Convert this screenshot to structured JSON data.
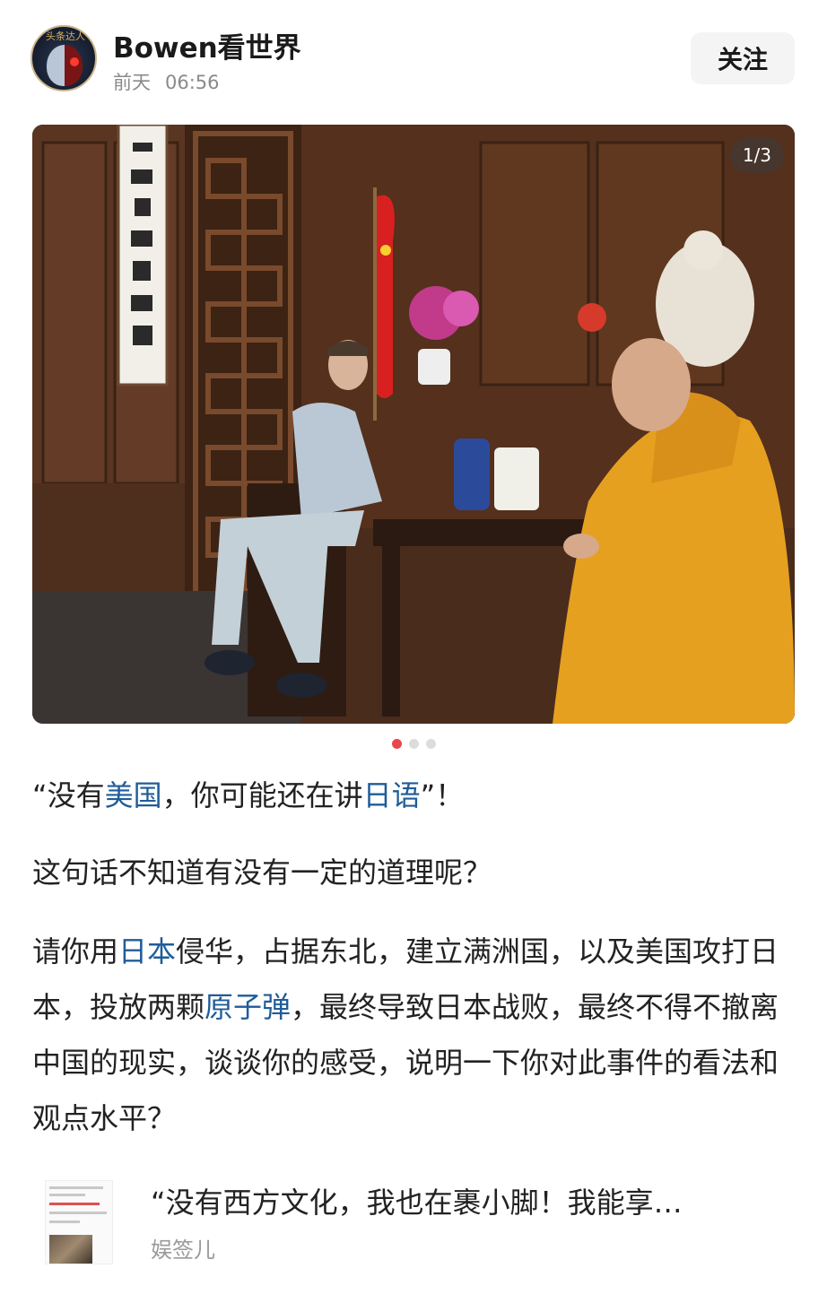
{
  "header": {
    "avatar_text": "头条达人",
    "author": "Bowen看世界",
    "date": "前天",
    "time": "06:56",
    "follow_label": "关注"
  },
  "gallery": {
    "counter": "1/3",
    "total": 3,
    "active_index": 0
  },
  "article": {
    "p1": [
      {
        "t": "“没有",
        "kw": false
      },
      {
        "t": "美国",
        "kw": true
      },
      {
        "t": "，你可能还在讲",
        "kw": false
      },
      {
        "t": "日语",
        "kw": true
      },
      {
        "t": "”！",
        "kw": false
      }
    ],
    "p2": [
      {
        "t": "这句话不知道有没有一定的道理呢？",
        "kw": false
      }
    ],
    "p3": [
      {
        "t": "请你用",
        "kw": false
      },
      {
        "t": "日本",
        "kw": true
      },
      {
        "t": "侵华，占据东北，建立满洲国，以及美国攻打日本，投放两颗",
        "kw": false
      },
      {
        "t": "原子弹",
        "kw": true
      },
      {
        "t": "，最终导致日本战败，最终不得不撤离中国的现实，谈谈你的感受，说明一下你对此事件的看法和观点水平？",
        "kw": false
      }
    ]
  },
  "related": {
    "title": "“没有西方文化，我也在裹小脚！我能享…",
    "source": "娱签儿"
  },
  "colors": {
    "keyword": "#1f5c99",
    "dot_active": "#e8474c",
    "dot_inactive": "#dcdcdc"
  }
}
